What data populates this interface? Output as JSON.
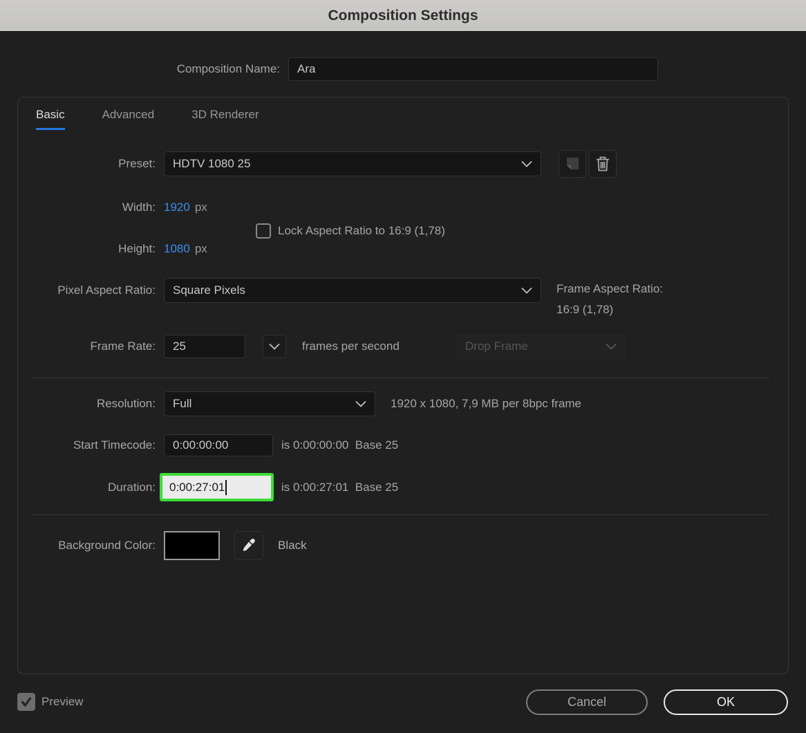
{
  "title": "Composition Settings",
  "name_row": {
    "label": "Composition Name:",
    "value": "Ara"
  },
  "tabs": {
    "basic": "Basic",
    "advanced": "Advanced",
    "renderer": "3D Renderer"
  },
  "preset": {
    "label": "Preset:",
    "value": "HDTV 1080 25"
  },
  "dimensions": {
    "width_label": "Width:",
    "width_value": "1920",
    "width_unit": "px",
    "height_label": "Height:",
    "height_value": "1080",
    "height_unit": "px",
    "lock_label": "Lock Aspect Ratio to 16:9 (1,78)",
    "lock_checked": false
  },
  "pixel_aspect_ratio": {
    "label": "Pixel Aspect Ratio:",
    "value": "Square Pixels"
  },
  "frame_aspect_ratio": {
    "label": "Frame Aspect Ratio:",
    "value": "16:9 (1,78)"
  },
  "frame_rate": {
    "label": "Frame Rate:",
    "value": "25",
    "unit_text": "frames per second",
    "drop_frame_label": "Drop Frame",
    "drop_frame_enabled": false
  },
  "resolution": {
    "label": "Resolution:",
    "value": "Full",
    "info": "1920 x 1080, 7,9 MB per 8bpc frame"
  },
  "start_timecode": {
    "label": "Start Timecode:",
    "value": "0:00:00:00",
    "info": "is 0:00:00:00  Base 25"
  },
  "duration": {
    "label": "Duration:",
    "value": "0:00:27:01",
    "info": "is 0:00:27:01  Base 25",
    "editing": true
  },
  "background_color": {
    "label": "Background Color:",
    "color_hex": "#000000",
    "color_name": "Black"
  },
  "footer": {
    "preview_label": "Preview",
    "preview_checked": true,
    "cancel_label": "Cancel",
    "ok_label": "OK"
  },
  "colors": {
    "accent_blue": "#3a8ee9",
    "tab_underline": "#2277e4",
    "duration_highlight_green": "#3cdd38",
    "titlebar_bg": "#c9c8c6",
    "dialog_bg": "#1f1f20"
  }
}
